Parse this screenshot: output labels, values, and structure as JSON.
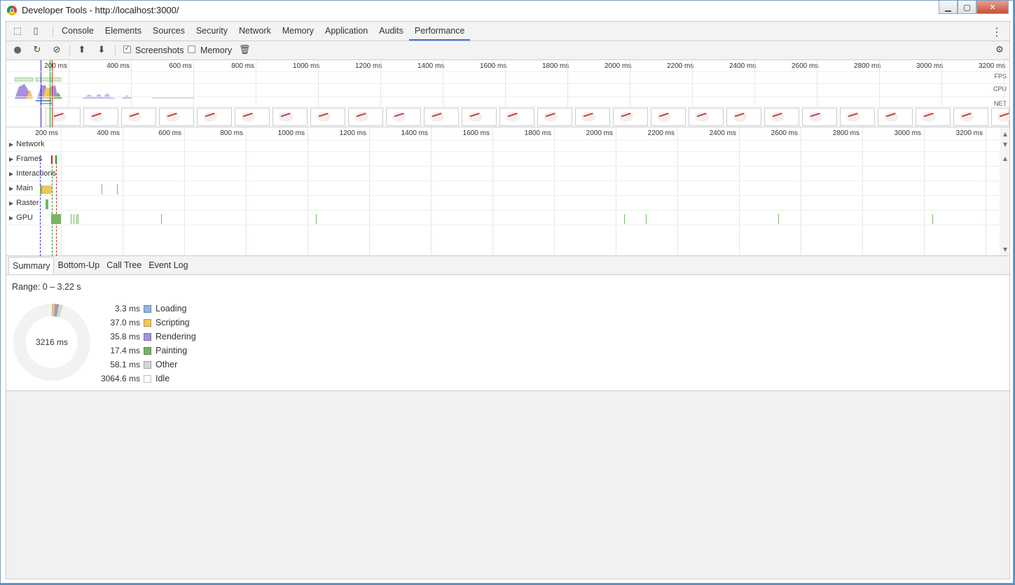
{
  "window": {
    "title": "Developer Tools - http://localhost:3000/",
    "controls": {
      "minimize": "▁",
      "maximize": "▢",
      "close": "✕"
    }
  },
  "tabbar": {
    "tabs": [
      "Console",
      "Elements",
      "Sources",
      "Security",
      "Network",
      "Memory",
      "Application",
      "Audits",
      "Performance"
    ],
    "active_tab": "Performance",
    "inspect_icon": "⬚",
    "device_icon": "▯",
    "menu_icon": "⋮"
  },
  "toolbar": {
    "record_icon": "●",
    "reload_icon": "↻",
    "clear_icon": "⊘",
    "upload_icon": "⬆",
    "download_icon": "⬇",
    "screenshots_label": "Screenshots",
    "screenshots_checked": true,
    "memory_label": "Memory",
    "memory_checked": false,
    "trash_icon": "🗑",
    "settings_icon": "⚙"
  },
  "overview": {
    "ticks": [
      "200 ms",
      "400 ms",
      "600 ms",
      "800 ms",
      "1000 ms",
      "1200 ms",
      "1400 ms",
      "1600 ms",
      "1800 ms",
      "2000 ms",
      "2200 ms",
      "2400 ms",
      "2600 ms",
      "2800 ms",
      "3000 ms",
      "3200 ms"
    ],
    "lanes": [
      "FPS",
      "CPU",
      "NET"
    ]
  },
  "flame": {
    "ticks": [
      "200 ms",
      "400 ms",
      "600 ms",
      "800 ms",
      "1000 ms",
      "1200 ms",
      "1400 ms",
      "1600 ms",
      "1800 ms",
      "2000 ms",
      "2200 ms",
      "2400 ms",
      "2600 ms",
      "2800 ms",
      "3000 ms",
      "3200 ms"
    ],
    "tracks": [
      "Network",
      "Frames",
      "Interactions",
      "Main",
      "Raster",
      "GPU"
    ],
    "expand_icon": "▶"
  },
  "bottom_tabs": [
    "Summary",
    "Bottom-Up",
    "Call Tree",
    "Event Log"
  ],
  "active_bottom_tab": "Summary",
  "summary": {
    "range": "Range: 0 – 3.22 s",
    "total": "3216 ms",
    "items": [
      {
        "value": "3.3 ms",
        "name": "Loading",
        "color": "#8fb6e6"
      },
      {
        "value": "37.0 ms",
        "name": "Scripting",
        "color": "#f0c75e"
      },
      {
        "value": "35.8 ms",
        "name": "Rendering",
        "color": "#a98fe0"
      },
      {
        "value": "17.4 ms",
        "name": "Painting",
        "color": "#75b565"
      },
      {
        "value": "58.1 ms",
        "name": "Other",
        "color": "#d6d6d6"
      },
      {
        "value": "3064.6 ms",
        "name": "Idle",
        "color": "#ffffff"
      }
    ]
  }
}
